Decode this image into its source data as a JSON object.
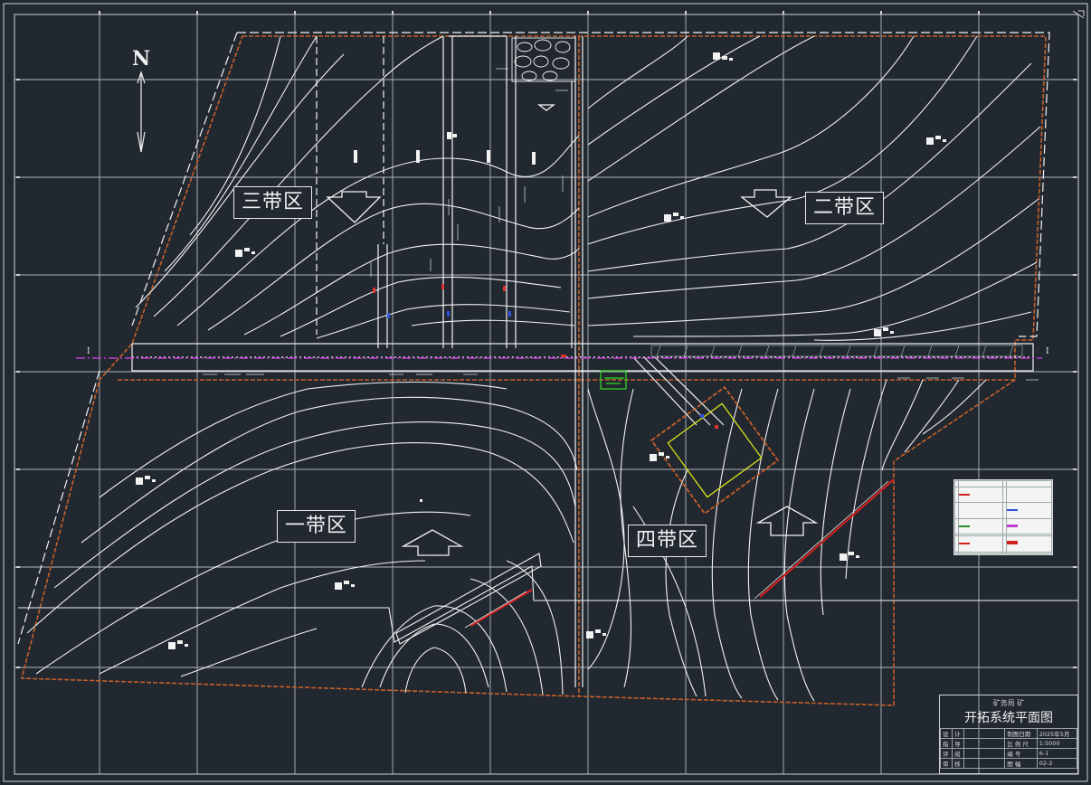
{
  "map": {
    "north_label": "N",
    "section_left": "I",
    "section_right": "I",
    "zones": [
      {
        "id": "zone-3",
        "label": "三带区"
      },
      {
        "id": "zone-2",
        "label": "二带区"
      },
      {
        "id": "zone-1",
        "label": "一带区"
      },
      {
        "id": "zone-4",
        "label": "四带区"
      }
    ]
  },
  "title_block": {
    "org": "矿务局   矿",
    "title": "开拓系统平面图",
    "rows": [
      {
        "c1": "设",
        "c2": "计",
        "c3": "",
        "c4": "制图日期",
        "c5": "2025年5月"
      },
      {
        "c1": "指",
        "c2": "导",
        "c3": "",
        "c4": "比 例 尺",
        "c5": "1:5000"
      },
      {
        "c1": "评",
        "c2": "阅",
        "c3": "",
        "c4": "编    号",
        "c5": "6-1"
      },
      {
        "c1": "审",
        "c2": "核",
        "c3": "",
        "c4": "图    幅",
        "c5": "02-2"
      }
    ]
  },
  "colors": {
    "background": "#212830",
    "grid": "#c9cfd6",
    "contour": "#f2f2f2",
    "boundary": "#c8602a",
    "section_line": "#c23cd2",
    "yellow_outline": "#d7e01a",
    "fault_red": "#d02020"
  }
}
